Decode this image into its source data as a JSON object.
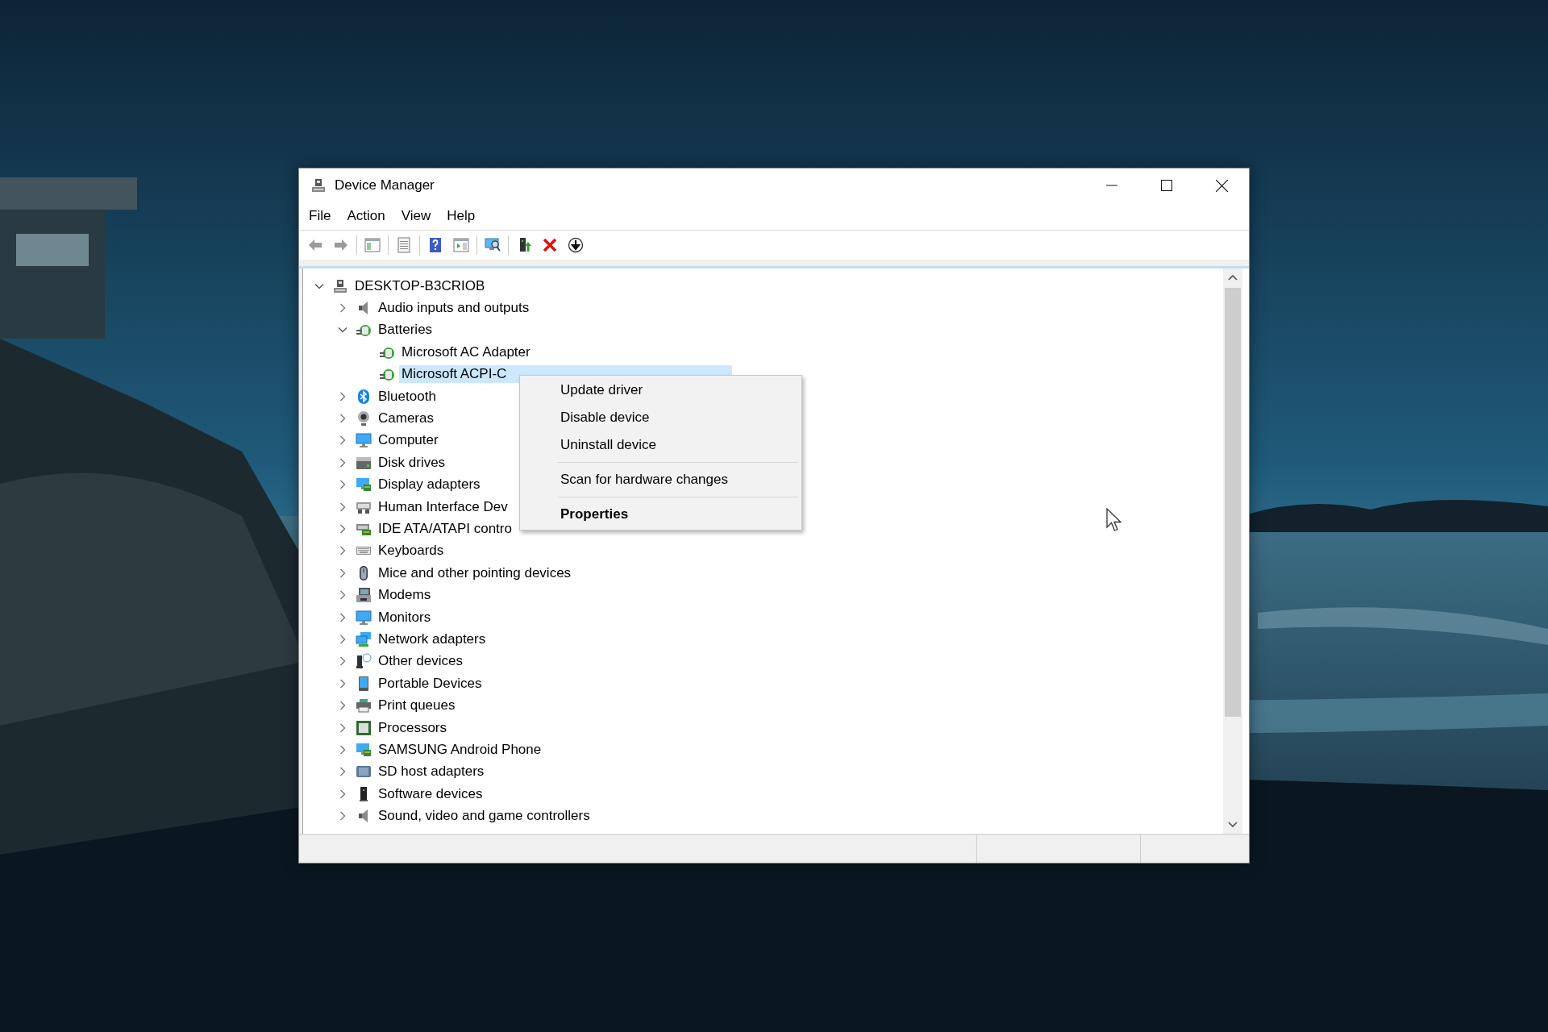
{
  "window": {
    "title": "Device Manager"
  },
  "menu": [
    "File",
    "Action",
    "View",
    "Help"
  ],
  "tree": {
    "label": "DESKTOP-B3CRIOB",
    "expanded": true,
    "selected": false,
    "children": [
      {
        "label": "Audio inputs and outputs",
        "expanded": false,
        "selected": false
      },
      {
        "label": "Batteries",
        "expanded": true,
        "selected": false,
        "children": [
          {
            "label": "Microsoft AC Adapter",
            "selected": false
          },
          {
            "label": "Microsoft ACPI-C",
            "selected": true
          }
        ]
      },
      {
        "label": "Bluetooth",
        "expanded": false,
        "selected": false
      },
      {
        "label": "Cameras",
        "expanded": false,
        "selected": false
      },
      {
        "label": "Computer",
        "expanded": false,
        "selected": false
      },
      {
        "label": "Disk drives",
        "expanded": false,
        "selected": false
      },
      {
        "label": "Display adapters",
        "expanded": false,
        "selected": false
      },
      {
        "label": "Human Interface Dev",
        "expanded": false,
        "selected": false
      },
      {
        "label": "IDE ATA/ATAPI contro",
        "expanded": false,
        "selected": false
      },
      {
        "label": "Keyboards",
        "expanded": false,
        "selected": false
      },
      {
        "label": "Mice and other pointing devices",
        "expanded": false,
        "selected": false
      },
      {
        "label": "Modems",
        "expanded": false,
        "selected": false
      },
      {
        "label": "Monitors",
        "expanded": false,
        "selected": false
      },
      {
        "label": "Network adapters",
        "expanded": false,
        "selected": false
      },
      {
        "label": "Other devices",
        "expanded": false,
        "selected": false
      },
      {
        "label": "Portable Devices",
        "expanded": false,
        "selected": false
      },
      {
        "label": "Print queues",
        "expanded": false,
        "selected": false
      },
      {
        "label": "Processors",
        "expanded": false,
        "selected": false
      },
      {
        "label": "SAMSUNG Android Phone",
        "expanded": false,
        "selected": false
      },
      {
        "label": "SD host adapters",
        "expanded": false,
        "selected": false
      },
      {
        "label": "Software devices",
        "expanded": false,
        "selected": false
      },
      {
        "label": "Sound, video and game controllers",
        "expanded": false,
        "selected": false
      }
    ]
  },
  "context_menu": {
    "groups": [
      [
        {
          "label": "Update driver",
          "default": false
        },
        {
          "label": "Disable device",
          "default": false
        },
        {
          "label": "Uninstall device",
          "default": false
        }
      ],
      [
        {
          "label": "Scan for hardware changes",
          "default": false
        }
      ],
      [
        {
          "label": "Properties",
          "default": true
        }
      ]
    ]
  }
}
